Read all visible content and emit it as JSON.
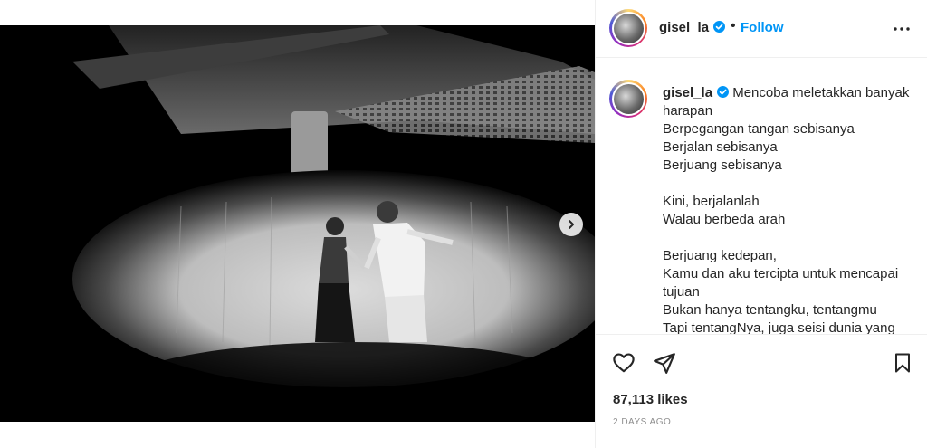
{
  "post": {
    "username": "gisel_la",
    "separator": "•",
    "follow_label": "Follow",
    "caption_lines": [
      "Mencoba meletakkan banyak",
      "harapan",
      "Berpegangan tangan sebisanya",
      "Berjalan sebisanya",
      "Berjuang sebisanya",
      "",
      "Kini, berjalanlah",
      "Walau berbeda arah",
      "",
      "Berjuang kedepan,",
      "Kamu dan aku tercipta untuk mencapai",
      "tujuan",
      "Bukan hanya tentangku, tentangmu",
      "Tapi tentangNya, juga seisi dunia yang"
    ],
    "likes": "87,113 likes",
    "date": "2 DAYS AGO"
  },
  "carousel": {
    "total": 5,
    "active_index": 0
  },
  "icons": {
    "verified": "verified-badge-icon",
    "more": "more-options-icon",
    "next": "chevron-right-icon",
    "like": "heart-icon",
    "share": "paper-plane-icon",
    "save": "bookmark-icon"
  },
  "colors": {
    "accent": "#0095f6",
    "text": "#262626",
    "muted": "#8e8e8e",
    "border": "#efefef"
  }
}
